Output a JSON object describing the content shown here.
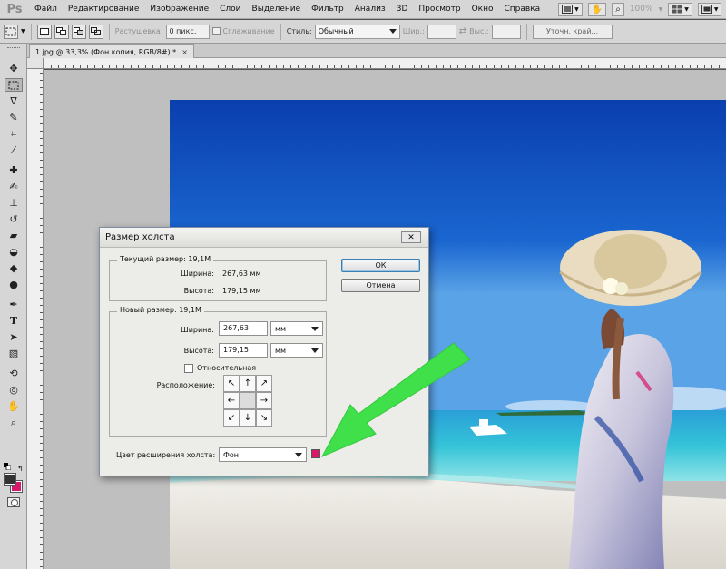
{
  "app": {
    "logo": "Ps"
  },
  "menu": [
    "Файл",
    "Редактирование",
    "Изображение",
    "Слои",
    "Выделение",
    "Фильтр",
    "Анализ",
    "3D",
    "Просмотр",
    "Окно",
    "Справка"
  ],
  "menubar_right": {
    "zoom": "100%"
  },
  "options_bar": {
    "feather_label": "Растушевка:",
    "feather_value": "0 пикс.",
    "antialias_label": "Сглаживание",
    "style_label": "Стиль:",
    "style_value": "Обычный",
    "width_label": "Шир.:",
    "height_label": "Выс.:",
    "refine_edge": "Уточн. край..."
  },
  "document_tab": {
    "title": "1.jpg @ 33,3% (Фон копия, RGB/8#) *",
    "close": "×"
  },
  "colors": {
    "foreground": "#333333",
    "background": "#d8196a",
    "arrow": "#3fe04a"
  },
  "dialog": {
    "title": "Размер холста",
    "close": "✕",
    "current": {
      "legend": "Текущий размер:",
      "size": "19,1M",
      "width_label": "Ширина:",
      "width_value": "267,63 мм",
      "height_label": "Высота:",
      "height_value": "179,15 мм"
    },
    "new": {
      "legend": "Новый размер:",
      "size": "19,1M",
      "width_label": "Ширина:",
      "width_value": "267,63",
      "width_unit": "мм",
      "height_label": "Высота:",
      "height_value": "179,15",
      "height_unit": "мм",
      "relative_label": "Относительная",
      "relative_checked": false,
      "anchor_label": "Расположение:"
    },
    "extension_label": "Цвет расширения холста:",
    "extension_value": "Фон",
    "ok": "ОК",
    "cancel": "Отмена"
  }
}
